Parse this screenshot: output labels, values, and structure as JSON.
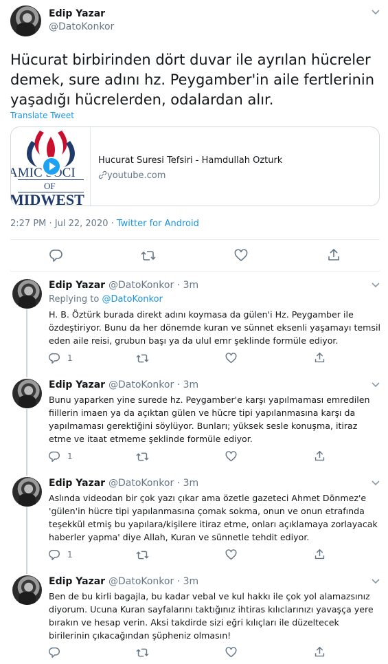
{
  "main_tweet": {
    "author_name": "Edip Yazar",
    "author_handle": "@DatoKonkor",
    "text": "Hücurat birbirinden dört duvar ile ayrılan hücreler demek, sure adını hz. Peygamber'in aile fertlerinin yaşadığı hücrelerden, odalardan alır.",
    "translate_label": "Translate Tweet",
    "card": {
      "title": "Hucurat Suresi Tefsiri - Hamdullah Ozturk",
      "domain": "youtube.com",
      "thumb_lines": [
        "AMIC SOCI",
        "OF",
        "MIDWEST"
      ]
    },
    "timestamp": "2:27 PM · Jul 22, 2020 · ",
    "source": "Twitter for Android"
  },
  "replies": [
    {
      "author_name": "Edip Yazar",
      "handle_time": "@DatoKonkor · 3m",
      "replying_prefix": "Replying to ",
      "replying_handle": "@DatoKonkor",
      "text": "H. B. Öztürk burada direkt adını koymasa da gülen'i Hz. Peygamber ile özdeştiriyor. Bunu da her dönemde kuran ve sünnet eksenli yaşamayı temsil eden aile reisi, grubun başı ya da ulul emr şeklinde formüle ediyor.",
      "reply_count": "1"
    },
    {
      "author_name": "Edip Yazar",
      "handle_time": "@DatoKonkor · 3m",
      "text": "Bunu yaparken yine surede hz. Peygamber'e karşı yapılmaması emredilen fiillerin imaen ya da açıktan gülen ve hücre tipi yapılanmasına karşı da yapılmaması gerektiğini söylüyor. Bunları; yüksek sesle konuşma, itiraz etme ve itaat etmeme şeklinde formüle ediyor.",
      "reply_count": "1"
    },
    {
      "author_name": "Edip Yazar",
      "handle_time": "@DatoKonkor · 3m",
      "text": "Aslında videodan bir çok yazı çıkar ama özetle gazeteci Ahmet Dönmez'e 'gülen'in hücre tipi yapılanmasına çomak sokma, onun ve onun etrafında teşekkül etmiş bu yapılara/kişilere itiraz etme, onları açıklamaya zorlayacak haberler yapma' diye Allah, Kuran ve sünnetle tehdit ediyor.",
      "reply_count": "1"
    },
    {
      "author_name": "Edip Yazar",
      "handle_time": "@DatoKonkor · 3m",
      "text": "Ben de bu kirli bagajla, bu kadar vebal ve kul hakkı ile çok yol alamazsınız diyorum. Ucuna Kuran sayfalarını taktığınız ihtiras kılıclarınızı yavaşça yere bırakın ve hesap verin. Aksi takdirde sizi eğri kılıçları ile düzeltecek birilerinin çıkacağından şüpheniz olmasın!",
      "reply_count": ""
    }
  ],
  "colors": {
    "text": "#14171a",
    "secondary": "#657786",
    "link": "#1b95e0",
    "border": "#e6ecf0",
    "play": "#1da1f2"
  },
  "icons": [
    "chevron-down-icon",
    "reply-icon",
    "retweet-icon",
    "like-icon",
    "share-icon",
    "play-icon",
    "link-icon"
  ]
}
